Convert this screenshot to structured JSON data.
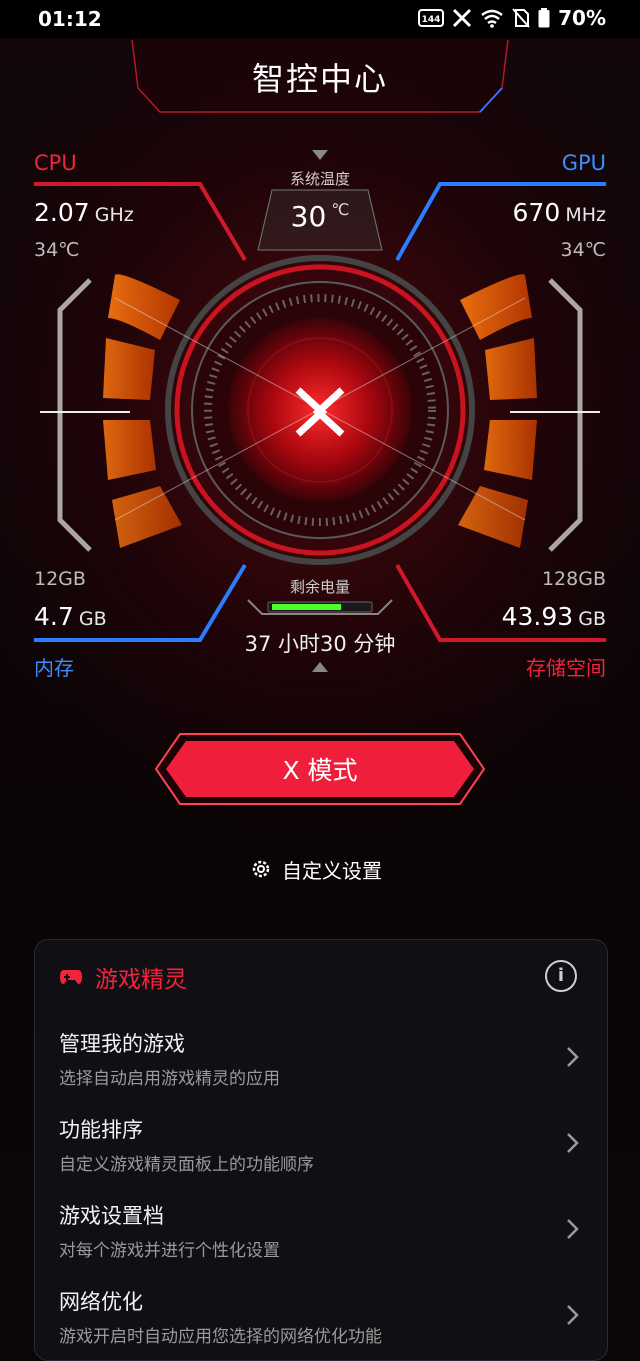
{
  "status_bar": {
    "time": "01:12",
    "refresh_badge": "144",
    "battery_pct": "70%"
  },
  "header": {
    "title": "智控中心"
  },
  "cpu": {
    "label": "CPU",
    "freq_value": "2.07",
    "freq_unit": "GHz",
    "temp": "34℃"
  },
  "gpu": {
    "label": "GPU",
    "freq_value": "670",
    "freq_unit": "MHz",
    "temp": "34℃"
  },
  "system_temp": {
    "label": "系统温度",
    "value": "30",
    "unit": "℃"
  },
  "memory": {
    "total": "12GB",
    "used_value": "4.7",
    "used_unit": "GB",
    "label": "内存"
  },
  "storage": {
    "total": "128GB",
    "used_value": "43.93",
    "used_unit": "GB",
    "label": "存储空间"
  },
  "battery": {
    "label": "剩余电量",
    "time_left": "37 小时30 分钟",
    "level": 0.72
  },
  "mode_button": {
    "label": "X 模式"
  },
  "custom_settings": {
    "label": "自定义设置"
  },
  "game_genie": {
    "title": "游戏精灵",
    "info_icon": "ⓘ",
    "items": [
      {
        "title": "管理我的游戏",
        "subtitle": "选择自动启用游戏精灵的应用"
      },
      {
        "title": "功能排序",
        "subtitle": "自定义游戏精灵面板上的功能顺序"
      },
      {
        "title": "游戏设置档",
        "subtitle": "对每个游戏并进行个性化设置"
      },
      {
        "title": "网络优化",
        "subtitle": "游戏开启时自动应用您选择的网络优化功能"
      }
    ]
  },
  "colors": {
    "accent_red": "#f2243a",
    "accent_blue": "#3b8dff",
    "orange": "#ff6a00"
  }
}
